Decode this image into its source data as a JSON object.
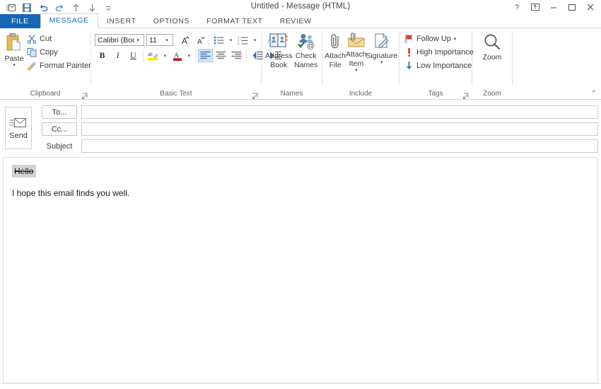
{
  "window": {
    "title": "Untitled - Message (HTML)",
    "quick_access": [
      {
        "name": "envelope-icon",
        "label": "Send/Receive"
      },
      {
        "name": "save-icon",
        "label": "Save"
      },
      {
        "name": "undo-icon",
        "label": "Undo"
      },
      {
        "name": "redo-icon",
        "label": "Redo"
      },
      {
        "name": "previous-item-icon",
        "label": "Previous Item"
      },
      {
        "name": "next-item-icon",
        "label": "Next Item"
      },
      {
        "name": "customize-quick-access-icon",
        "label": "Customize Quick Access Toolbar"
      }
    ],
    "controls": {
      "help": "?",
      "ribbon_display": "Ribbon Display Options",
      "minimize": "Minimize",
      "maximize": "Maximize",
      "close": "Close"
    }
  },
  "tabs": [
    {
      "label": "FILE",
      "active": false,
      "file": true
    },
    {
      "label": "MESSAGE",
      "active": true,
      "file": false
    },
    {
      "label": "INSERT",
      "active": false,
      "file": false
    },
    {
      "label": "OPTIONS",
      "active": false,
      "file": false
    },
    {
      "label": "FORMAT TEXT",
      "active": false,
      "file": false
    },
    {
      "label": "REVIEW",
      "active": false,
      "file": false
    }
  ],
  "ribbon": {
    "collapse_label": "⌃",
    "groups": {
      "clipboard": {
        "label": "Clipboard",
        "paste": "Paste",
        "paste_caret": "▾",
        "cut": "Cut",
        "copy": "Copy",
        "format_painter": "Format Painter",
        "dialog_launcher": "Clipboard dialog launcher"
      },
      "basic_text": {
        "label": "Basic Text",
        "font_name": "Calibri (Boc",
        "font_size": "11",
        "grow_font": "A",
        "shrink_font": "A",
        "bullets": "Bullets",
        "numbering": "Numbering",
        "clear_formatting": "Clear All Formatting",
        "bold": "B",
        "italic": "I",
        "underline": "U",
        "highlight": "Text Highlight Color",
        "font_color": "A",
        "align_left": "Align Left",
        "align_center": "Center",
        "align_right": "Align Right",
        "decrease_indent": "Decrease Indent",
        "increase_indent": "Increase Indent",
        "dialog_launcher": "Basic Text dialog launcher"
      },
      "names": {
        "label": "Names",
        "address_book": "Address\nBook",
        "address_book_l1": "Address",
        "address_book_l2": "Book",
        "check_names_l1": "Check",
        "check_names_l2": "Names"
      },
      "include": {
        "label": "Include",
        "attach_file_l1": "Attach",
        "attach_file_l2": "File",
        "attach_item_l1": "Attach",
        "attach_item_l2": "Item",
        "attach_item_caret": "▾",
        "signature": "Signature",
        "signature_caret": "▾"
      },
      "tags": {
        "label": "Tags",
        "follow_up": "Follow Up",
        "follow_up_caret": "▾",
        "high_importance": "High Importance",
        "low_importance": "Low Importance",
        "dialog_launcher": "Tags dialog launcher"
      },
      "zoom": {
        "label": "Zoom",
        "button": "Zoom"
      }
    }
  },
  "compose": {
    "send_button": "Send",
    "to_button": "To...",
    "cc_button": "Cc...",
    "subject_label": "Subject",
    "to_value": "",
    "cc_value": "",
    "subject_value": ""
  },
  "message_body": {
    "selected_text": "Hello",
    "paragraph": "I hope this email finds you well."
  },
  "colors": {
    "file_tab": "#1567b5",
    "active_tab_text": "#1e72b8",
    "highlight_yellow": "#ffe800",
    "font_color_red": "#c00000",
    "flag_red": "#e03a2f",
    "importance_blue": "#2a6ebb",
    "selection_gray": "#d2d2d2",
    "paste_gold": "#e8b94e"
  }
}
